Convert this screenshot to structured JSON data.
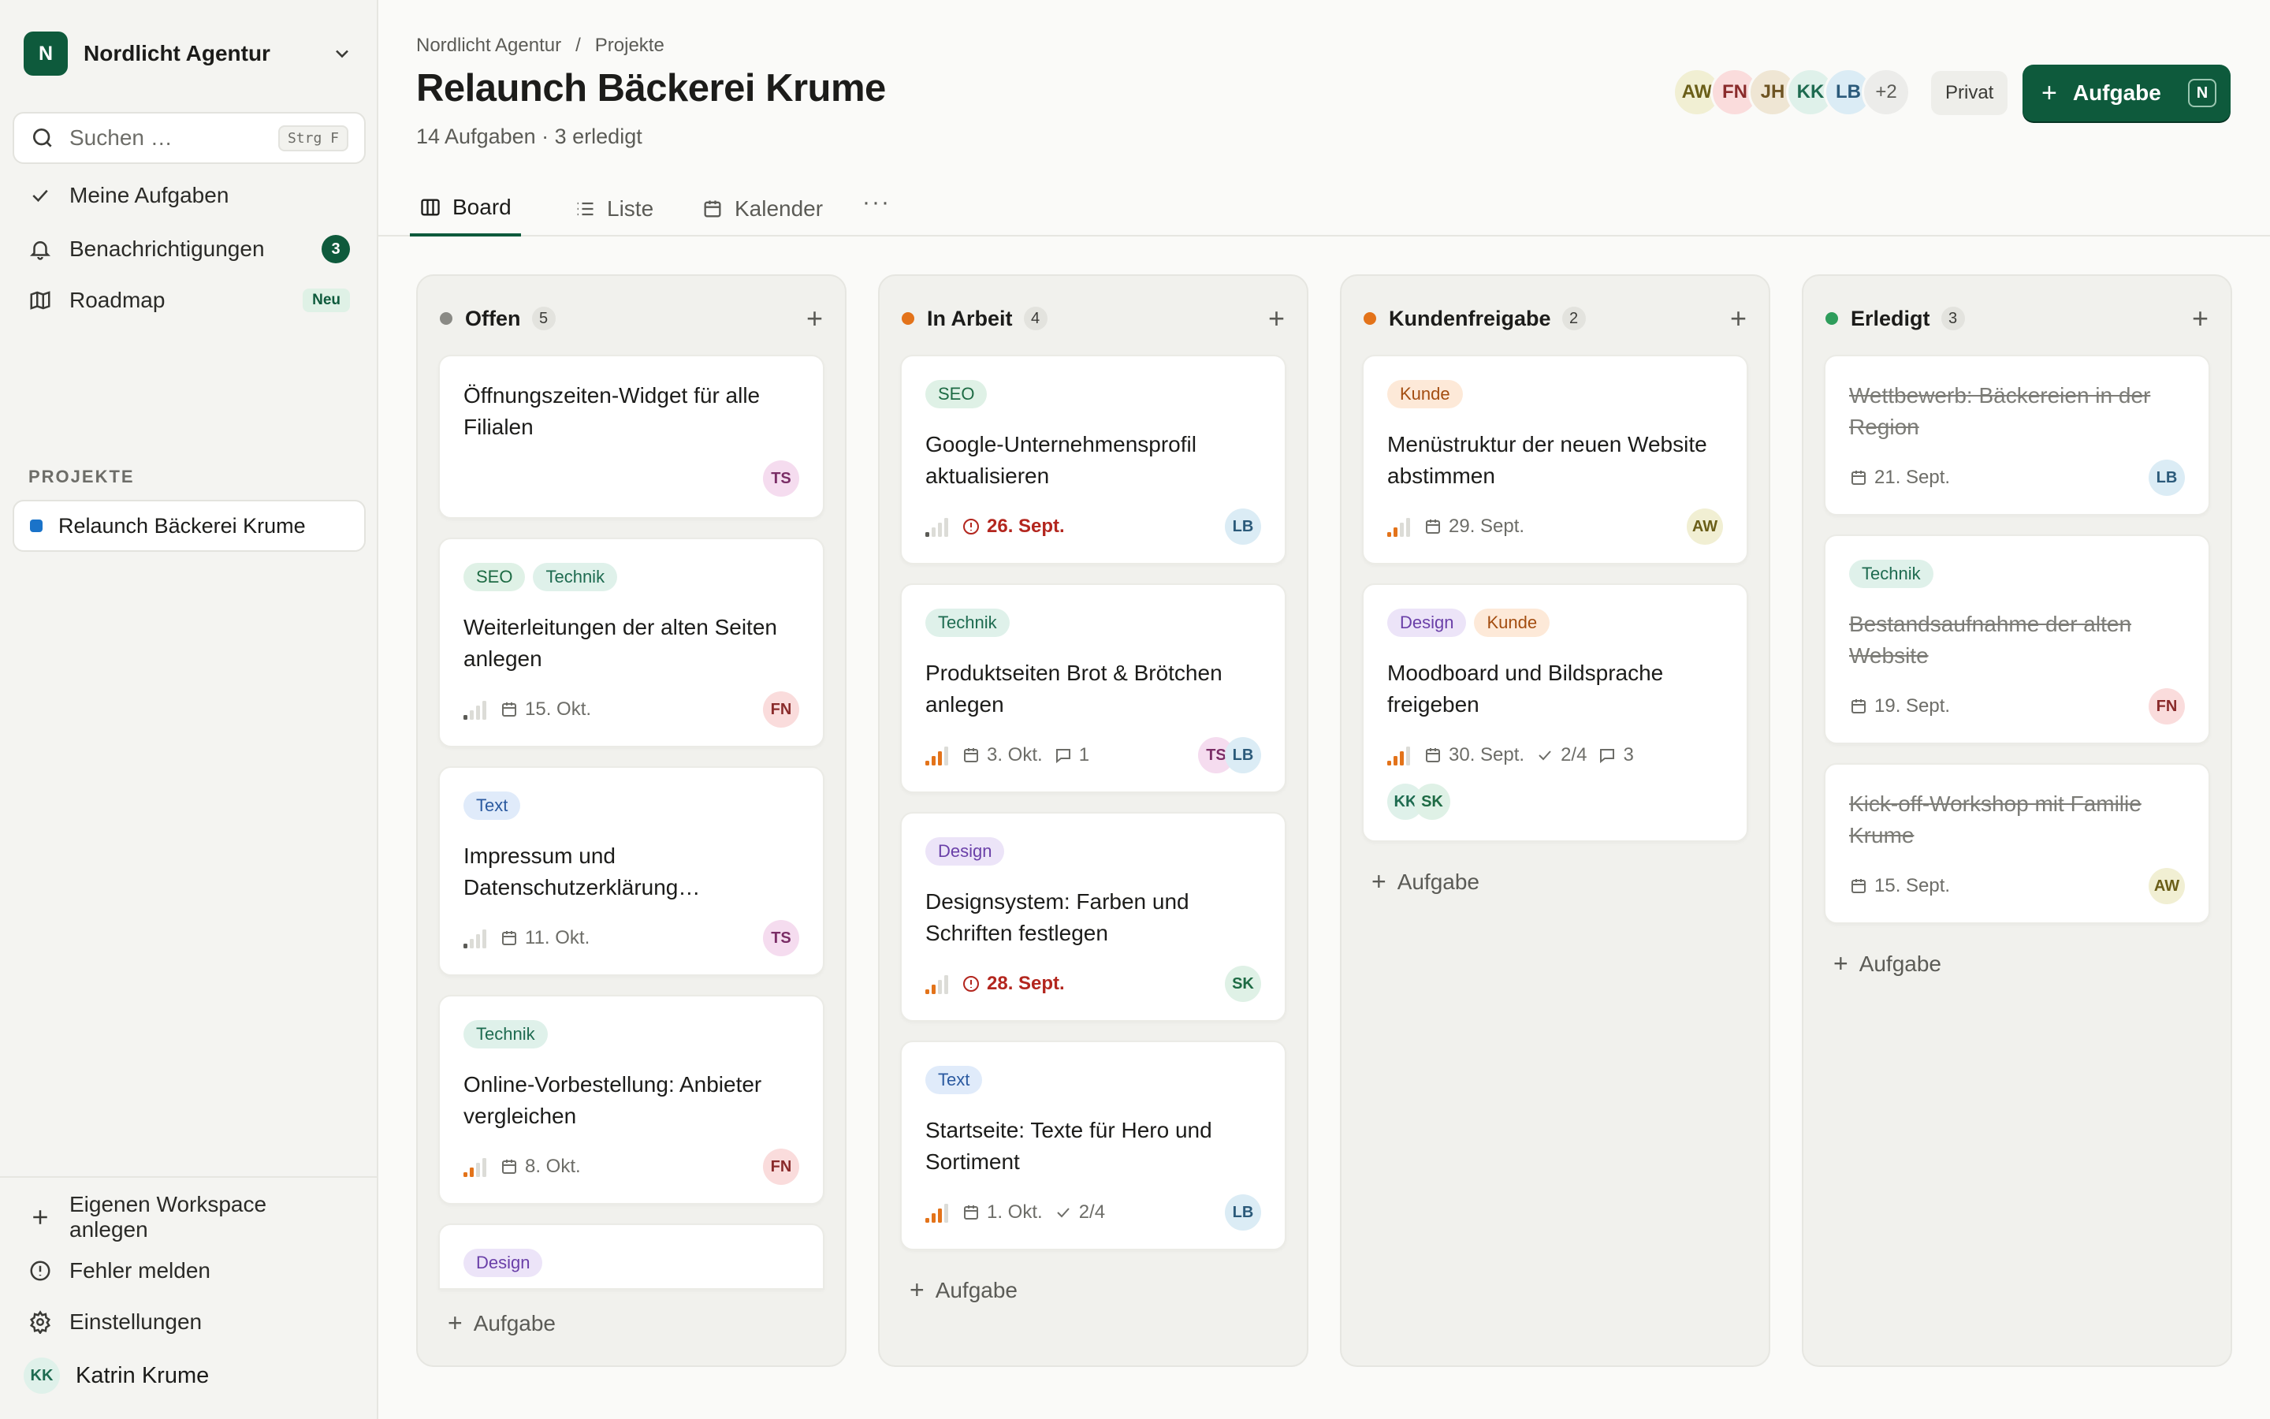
{
  "workspace": {
    "initial": "N",
    "name": "Nordlicht Agentur"
  },
  "search": {
    "placeholder": "Suchen …",
    "shortcut": "Strg F"
  },
  "nav": [
    {
      "label": "Meine Aufgaben",
      "icon": "check-icon"
    },
    {
      "label": "Benachrichtigungen",
      "icon": "bell-icon",
      "badge": "3"
    },
    {
      "label": "Roadmap",
      "icon": "map-icon",
      "badge": "Neu"
    }
  ],
  "projects": {
    "title": "PROJEKTE",
    "items": [
      {
        "label": "Relaunch Bäckerei Krume",
        "color": "#1a73c9"
      }
    ]
  },
  "footer": [
    {
      "label": "Eigenen Workspace anlegen",
      "icon": "plus-icon"
    },
    {
      "label": "Fehler melden",
      "icon": "alert-circle-icon"
    },
    {
      "label": "Einstellungen",
      "icon": "gear-icon"
    }
  ],
  "user": {
    "initials": "KK",
    "name": "Katrin Krume"
  },
  "header": {
    "breadcrumb": [
      "Nordlicht Agentur",
      "/",
      "Projekte"
    ],
    "title": "Relaunch Bäckerei Krume",
    "subtitle": "14 Aufgaben · 3 erledigt",
    "members": [
      "AW",
      "FN",
      "JH",
      "KK",
      "LB",
      "+2"
    ],
    "visibility": "Privat",
    "add_label": "Aufgabe",
    "add_shortcut": "N"
  },
  "tabs": [
    {
      "label": "Board",
      "active": true
    },
    {
      "label": "Liste"
    },
    {
      "label": "Kalender"
    }
  ],
  "add_task_label": "Aufgabe",
  "colors": {
    "accent": "#0e5a3c",
    "overdue": "#b3261e",
    "priority_orange": "#e3731a"
  },
  "columns": [
    {
      "name": "Offen",
      "count": "5",
      "dot": "#8a8a85",
      "cards": [
        {
          "title": "Öffnungszeiten-Widget für alle Filialen",
          "tags": [],
          "avatars": [
            "TS"
          ]
        },
        {
          "title": "Weiterleitungen der alten Seiten anlegen",
          "tags": [
            "SEO",
            "Technik"
          ],
          "priority": 1,
          "date": "15. Okt.",
          "avatars": [
            "FN"
          ]
        },
        {
          "title": "Impressum und Datenschutzerklärung…",
          "tags": [
            "Text"
          ],
          "priority": 1,
          "date": "11. Okt.",
          "avatars": [
            "TS"
          ]
        },
        {
          "title": "Online-Vorbestellung: Anbieter vergleichen",
          "tags": [
            "Technik"
          ],
          "priority": 2,
          "date": "8. Okt.",
          "avatars": [
            "FN"
          ]
        },
        {
          "title": "",
          "tags": [
            "Design"
          ],
          "avatars": []
        }
      ]
    },
    {
      "name": "In Arbeit",
      "count": "4",
      "dot": "#e3731a",
      "cards": [
        {
          "title": "Google-Unternehmensprofil aktualisieren",
          "tags": [
            "SEO"
          ],
          "priority": 1,
          "date": "26. Sept.",
          "overdue": true,
          "avatars": [
            "LB"
          ]
        },
        {
          "title": "Produktseiten Brot & Brötchen anlegen",
          "tags": [
            "Technik"
          ],
          "priority": 3,
          "date": "3. Okt.",
          "comments": "1",
          "avatars": [
            "TS",
            "LB"
          ]
        },
        {
          "title": "Designsystem: Farben und Schriften festlegen",
          "tags": [
            "Design"
          ],
          "priority": 2,
          "date": "28. Sept.",
          "overdue": true,
          "avatars": [
            "SK"
          ]
        },
        {
          "title": "Startseite: Texte für Hero und Sortiment",
          "tags": [
            "Text"
          ],
          "priority": 3,
          "date": "1. Okt.",
          "subtasks": "2/4",
          "avatars": [
            "LB"
          ]
        }
      ]
    },
    {
      "name": "Kundenfreigabe",
      "count": "2",
      "dot": "#e3731a",
      "cards": [
        {
          "title": "Menüstruktur der neuen Website abstimmen",
          "tags": [
            "Kunde"
          ],
          "priority": 2,
          "date": "29. Sept.",
          "avatars": [
            "AW"
          ]
        },
        {
          "title": "Moodboard und Bildsprache freigeben",
          "tags": [
            "Design",
            "Kunde"
          ],
          "priority": 3,
          "date": "30. Sept.",
          "subtasks": "2/4",
          "comments": "3",
          "avatars": [
            "KK",
            "SK"
          ]
        }
      ]
    },
    {
      "name": "Erledigt",
      "count": "3",
      "dot": "#2e9d5b",
      "cards": [
        {
          "title": "Wettbewerb: Bäckereien in der Region",
          "tags": [],
          "date": "21. Sept.",
          "done": true,
          "avatars": [
            "LB"
          ]
        },
        {
          "title": "Bestandsaufnahme der alten Website",
          "tags": [
            "Technik"
          ],
          "date": "19. Sept.",
          "done": true,
          "avatars": [
            "FN"
          ]
        },
        {
          "title": "Kick-off-Workshop mit Familie Krume",
          "tags": [],
          "date": "15. Sept.",
          "done": true,
          "avatars": [
            "AW"
          ]
        }
      ]
    }
  ]
}
